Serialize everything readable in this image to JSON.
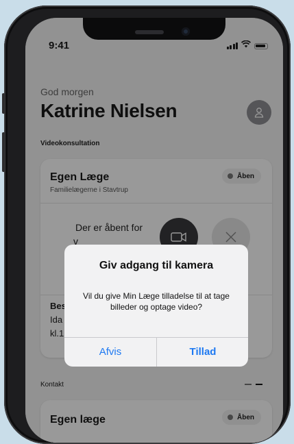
{
  "status_bar": {
    "time": "9:41"
  },
  "header": {
    "greeting": "God morgen",
    "user_name": "Katrine Nielsen",
    "avatar_icon": "user-icon"
  },
  "sections": {
    "video": "Videokonsultation",
    "contact": "Kontakt"
  },
  "video_card": {
    "title": "Egen Læge",
    "subtitle": "Familielægerne i Stavtrup",
    "badge": "Åben",
    "open_text_line1": "Der er åbent for",
    "open_text_line2": "v",
    "info_heading": "Bes",
    "info_line1": "Ida",
    "info_line2": "kl.1"
  },
  "contact_card": {
    "title": "Egen læge",
    "badge": "Åben"
  },
  "alert": {
    "title": "Giv adgang til kamera",
    "message": "Vil du give Min Læge tilladelse til at tage billeder og optage video?",
    "deny_label": "Afvis",
    "allow_label": "Tillad"
  },
  "colors": {
    "accent": "#1d79f2",
    "background": "#c9dde9"
  }
}
